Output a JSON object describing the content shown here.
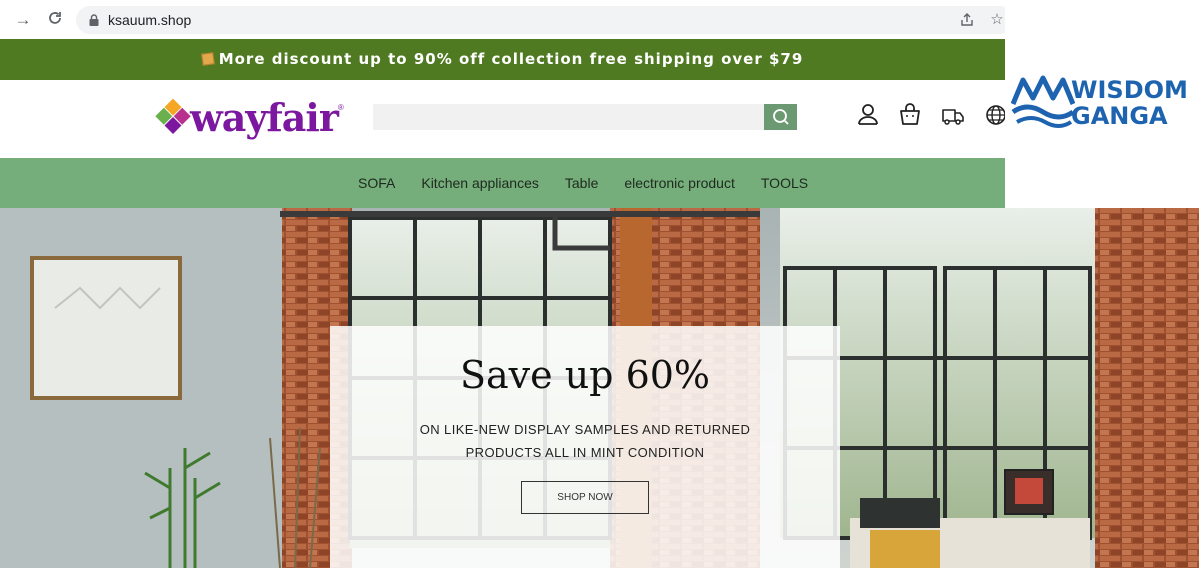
{
  "browser": {
    "url": "ksauum.shop",
    "icons": [
      "forward-icon",
      "reload-icon",
      "lock-icon",
      "share-icon",
      "bookmark-star-icon"
    ]
  },
  "announcement": {
    "text": "More discount up to 90% off collection free shipping over $79",
    "background": "#4f7a21"
  },
  "header": {
    "logo_text": "wayfair",
    "logo_colors": [
      "#7b189f",
      "#f5a623",
      "#6ab04c",
      "#b8318e"
    ],
    "search_placeholder": "",
    "icons": [
      "search-icon",
      "account-icon",
      "cart-icon",
      "tracking-icon",
      "language-icon"
    ]
  },
  "nav": {
    "background": "#75ad7b",
    "items": [
      "SOFA",
      "Kitchen appliances",
      "Table",
      "electronic product",
      "TOOLS"
    ]
  },
  "watermark": {
    "line1": "WISDOM",
    "line2": "GANGA",
    "color": "#1e63b0"
  },
  "hero": {
    "title": "Save up 60%",
    "subtitle_line1": "ON LIKE-NEW DISPLAY SAMPLES AND RETURNED",
    "subtitle_line2": "PRODUCTS ALL IN MINT CONDITION",
    "button_label": "SHOP NOW"
  }
}
